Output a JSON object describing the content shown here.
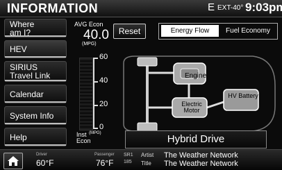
{
  "header": {
    "title": "INFORMATION",
    "compass": "E",
    "outside_temp": "EXT-40°",
    "clock": "9:03pm"
  },
  "sidebar": {
    "items": [
      {
        "label": "Where am I?"
      },
      {
        "label": "HEV"
      },
      {
        "label": "SIRIUS Travel Link"
      },
      {
        "label": "Calendar"
      },
      {
        "label": "System Info"
      },
      {
        "label": "Help"
      }
    ]
  },
  "econ": {
    "avg_label": "AVG Econ",
    "avg_value": "40.0",
    "avg_unit": "(MPG)",
    "reset_label": "Reset",
    "inst_label": "Inst Econ",
    "inst_unit": "(MPG)",
    "scale_ticks": [
      "60",
      "40",
      "20",
      "0"
    ]
  },
  "tabs": {
    "energy_flow": "Energy Flow",
    "fuel_economy": "Fuel Economy"
  },
  "diagram": {
    "engine_label": "Engine",
    "motor_label": "Electric Motor",
    "battery_label": "HV Battery",
    "mode": "Hybrid Drive"
  },
  "bottom": {
    "driver_label": "Driver",
    "driver_temp": "60°F",
    "passenger_label": "Passenger",
    "passenger_temp": "76°F",
    "source": "SR1",
    "channel": "185",
    "artist_label": "Artist",
    "artist_value": "The Weather Network",
    "title_label": "Title",
    "title_value": "The Weather Network"
  }
}
